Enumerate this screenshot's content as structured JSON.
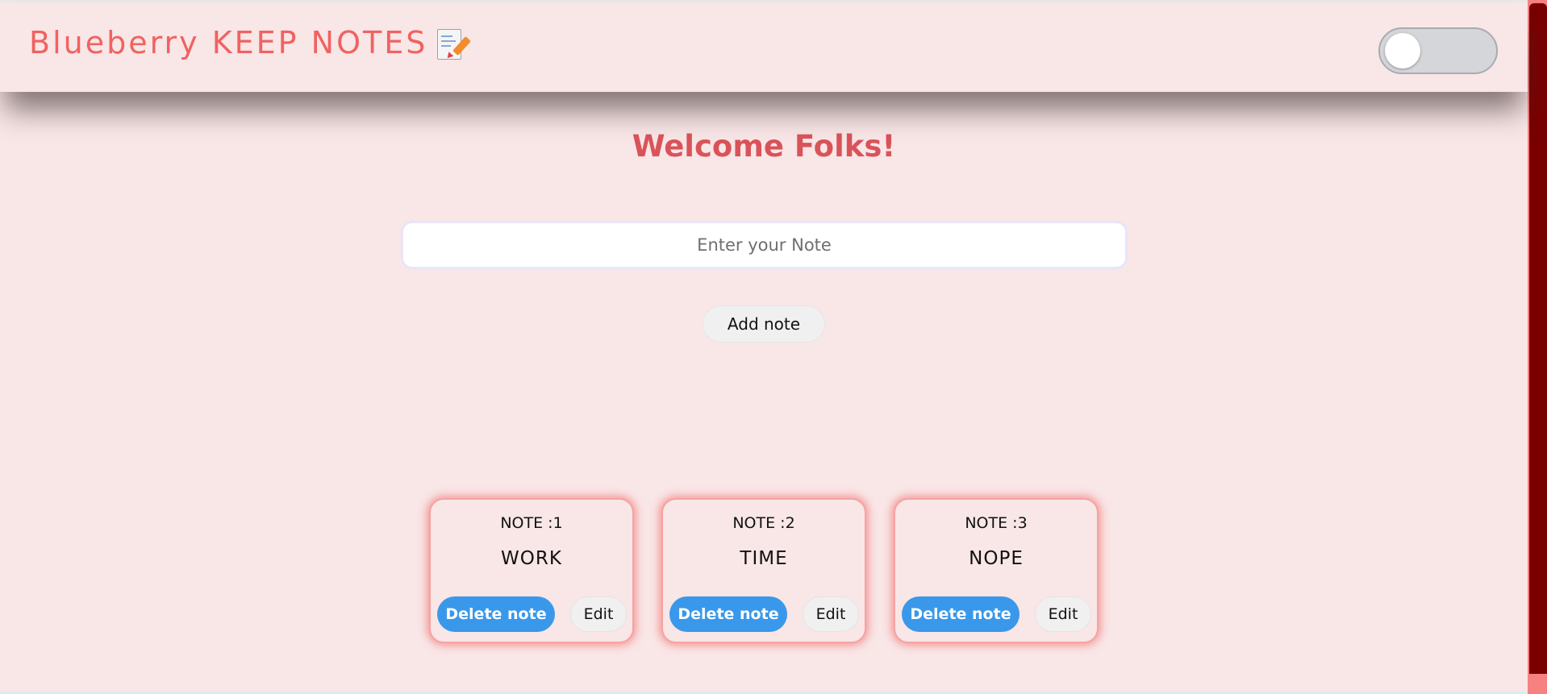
{
  "app": {
    "brand_title": "Blueberry KEEP NOTES",
    "brand_icon": "memo-pencil-icon",
    "theme_toggle_state": "off"
  },
  "colors": {
    "brand": "#f06262",
    "welcome": "#d9545a",
    "background": "#f9e6e6",
    "delete_button": "#3a98ea",
    "scrollbar_thumb": "#7a0000",
    "scrollbar_track": "#f78181"
  },
  "main": {
    "welcome": "Welcome Folks!",
    "input_placeholder": "Enter your Note",
    "input_value": "",
    "add_button": "Add note"
  },
  "notes": [
    {
      "number_label": "NOTE :1",
      "text": "WORK",
      "delete_label": "Delete note",
      "edit_label": "Edit"
    },
    {
      "number_label": "NOTE :2",
      "text": "TIME",
      "delete_label": "Delete note",
      "edit_label": "Edit"
    },
    {
      "number_label": "NOTE :3",
      "text": "NOPE",
      "delete_label": "Delete note",
      "edit_label": "Edit"
    }
  ]
}
